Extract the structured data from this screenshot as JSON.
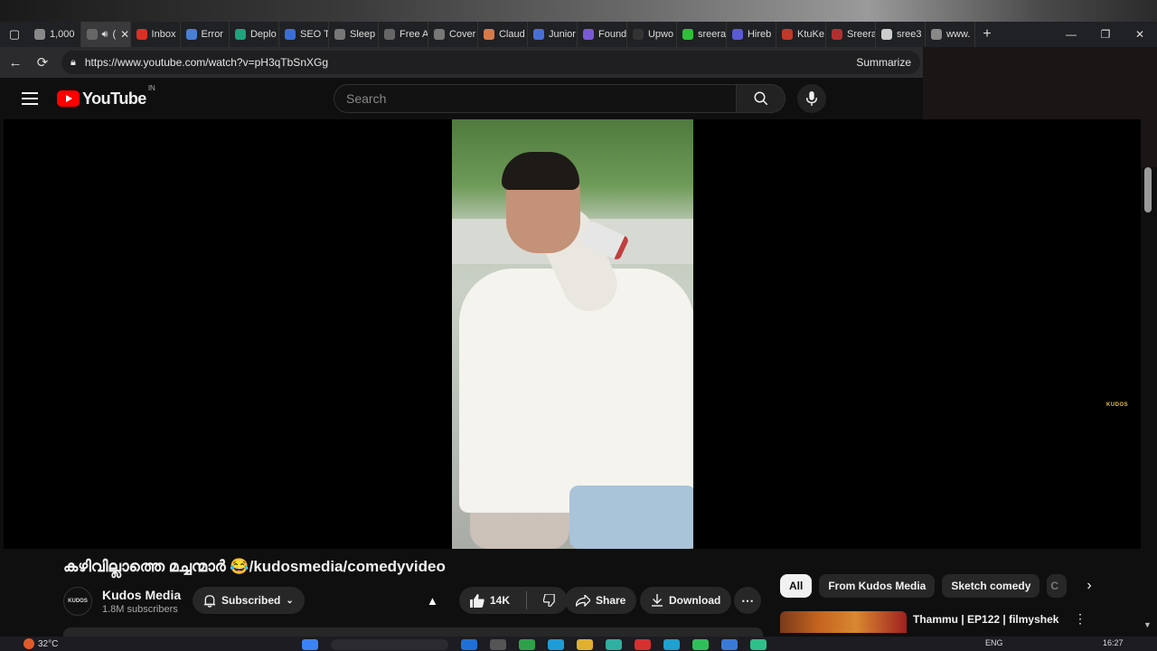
{
  "browser": {
    "tabs": [
      {
        "label": "1,000",
        "color": "#888888",
        "active": false
      },
      {
        "label": "(",
        "color": "#666666",
        "active": true
      },
      {
        "label": "Inbox",
        "color": "#d93025",
        "active": false
      },
      {
        "label": "Error",
        "color": "#4a7fd4",
        "active": false
      },
      {
        "label": "Deplo",
        "color": "#1fa37a",
        "active": false
      },
      {
        "label": "SEO T",
        "color": "#3b6fd6",
        "active": false
      },
      {
        "label": "Sleep",
        "color": "#777777",
        "active": false
      },
      {
        "label": "Free A",
        "color": "#666666",
        "active": false
      },
      {
        "label": "Cover",
        "color": "#777777",
        "active": false
      },
      {
        "label": "Claud",
        "color": "#d67a4a",
        "active": false
      },
      {
        "label": "Junior",
        "color": "#4a6fd4",
        "active": false
      },
      {
        "label": "Found",
        "color": "#7a5ad4",
        "active": false
      },
      {
        "label": "Upwo",
        "color": "#333333",
        "active": false
      },
      {
        "label": "sreera",
        "color": "#2fbf3a",
        "active": false
      },
      {
        "label": "Hireb",
        "color": "#5a5ad4",
        "active": false
      },
      {
        "label": "KtuKe",
        "color": "#c0392b",
        "active": false
      },
      {
        "label": "Sreera",
        "color": "#b03030",
        "active": false
      },
      {
        "label": "sree3",
        "color": "#cccccc",
        "active": false
      },
      {
        "label": "www.",
        "color": "#888888",
        "active": false
      }
    ],
    "url": "https://www.youtube.com/watch?v=pH3qTbSnXGg",
    "summarize_label": "Summarize"
  },
  "youtube": {
    "logo_text": "YouTube",
    "country_code": "IN",
    "search_placeholder": "Search"
  },
  "video": {
    "title": "കഴിവില്ലാത്തെ മച്ചന്മാർ 😂/kudosmedia/comedyvideo",
    "watermark": "KUDOS",
    "channel": {
      "name": "Kudos Media",
      "subscribers": "1.8M subscribers",
      "avatar_text": "KUDOS"
    },
    "subscribed_label": "Subscribed",
    "likes": "14K",
    "share_label": "Share",
    "download_label": "Download"
  },
  "chips": [
    {
      "label": "All",
      "active": true
    },
    {
      "label": "From Kudos Media",
      "active": false
    },
    {
      "label": "Sketch comedy",
      "active": false
    },
    {
      "label": "C",
      "active": false
    }
  ],
  "recommendation": {
    "title": "Thammu | EP122 | filmyshek"
  },
  "taskbar": {
    "temperature": "32°C",
    "language": "ENG",
    "time": "16:27"
  }
}
